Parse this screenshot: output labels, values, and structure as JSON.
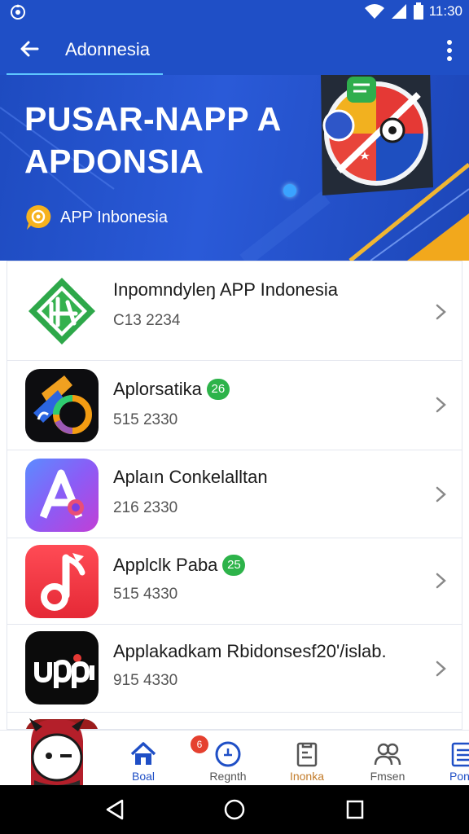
{
  "status_bar": {
    "time": "11:30",
    "icons": [
      "app-notification-icon",
      "wifi-icon",
      "signal-icon",
      "battery-icon"
    ]
  },
  "app_bar": {
    "title": "Adonnesia",
    "icons": [
      "back-arrow-icon",
      "more-vert-icon"
    ]
  },
  "banner": {
    "headline_line1": "PUSAR-NAPP A",
    "headline_line2": "APDONSIA",
    "sub_label": "APP Inbonesia"
  },
  "apps": [
    {
      "name": "Inpomndyleŋ APP Indonesia",
      "sub": "C13 2234",
      "badge": "",
      "icon": "green-leaf-logo-icon"
    },
    {
      "name": "Aplorsatika",
      "sub": "515 2330",
      "badge": "26",
      "icon": "colorful-circle-logo-icon"
    },
    {
      "name": "Aplaın Conkelalltan",
      "sub": "216 2330",
      "badge": "",
      "icon": "letter-a-logo-icon"
    },
    {
      "name": "Applclk Paba",
      "sub": "515 4330",
      "badge": "25",
      "icon": "music-note-logo-icon"
    },
    {
      "name": "Applakadkam Rbidonsesf20'/islab.",
      "sub": "915 4330",
      "badge": "",
      "icon": "uppi-logo-icon"
    }
  ],
  "bottom_nav": {
    "items": [
      {
        "label": "Boal",
        "icon": "home-icon"
      },
      {
        "label": "Regnth",
        "icon": "clock-icon",
        "badge": "6"
      },
      {
        "label": "Inonka",
        "icon": "document-icon"
      },
      {
        "label": "Fmsen",
        "icon": "people-icon"
      },
      {
        "label": "Pon",
        "icon": "list-icon"
      }
    ]
  },
  "colors": {
    "primary": "#1f4fc6",
    "accent_badge": "#2db34a",
    "nav_active": "#1f4fc6",
    "notification": "#e5402f"
  }
}
